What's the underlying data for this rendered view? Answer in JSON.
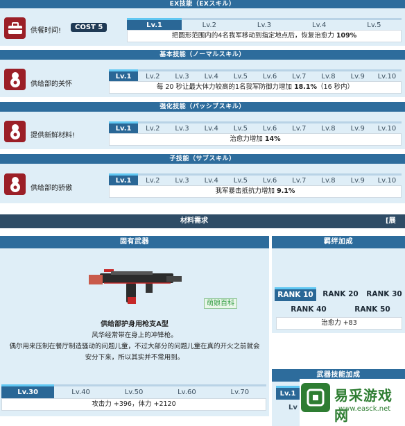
{
  "ex_skill": {
    "header": "EX技能（EXスキル）",
    "name": "供餐时间!",
    "cost": "COST 5",
    "levels": [
      "Lv.1",
      "Lv.2",
      "Lv.3",
      "Lv.4",
      "Lv.5"
    ],
    "desc_pre": "把圆形范围内的4名我军移动到指定地点后，恢复治愈力 ",
    "desc_bold": "109%"
  },
  "basic_skill": {
    "header": "基本技能（ノーマルスキル）",
    "name": "供给部的关怀",
    "levels": [
      "Lv.1",
      "Lv.2",
      "Lv.3",
      "Lv.4",
      "Lv.5",
      "Lv.6",
      "Lv.7",
      "Lv.8",
      "Lv.9",
      "Lv.10"
    ],
    "desc_pre": "每 20 秒让最大体力较高的1名我军防御力增加 ",
    "desc_bold": "18.1%",
    "desc_post": "（16 秒内）"
  },
  "enhanced_skill": {
    "header": "强化技能（パッシブスキル）",
    "name": "提供新鲜材料!",
    "levels": [
      "Lv.1",
      "Lv.2",
      "Lv.3",
      "Lv.4",
      "Lv.5",
      "Lv.6",
      "Lv.7",
      "Lv.8",
      "Lv.9",
      "Lv.10"
    ],
    "desc_pre": "治愈力增加 ",
    "desc_bold": "14%"
  },
  "sub_skill": {
    "header": "子技能（サブスキル）",
    "name": "供给部的骄傲",
    "levels": [
      "Lv.1",
      "Lv.2",
      "Lv.3",
      "Lv.4",
      "Lv.5",
      "Lv.6",
      "Lv.7",
      "Lv.8",
      "Lv.9",
      "Lv.10"
    ],
    "desc_pre": "我军暴击抵抗力增加 ",
    "desc_bold": "9.1%"
  },
  "materials": {
    "label": "材料需求",
    "expand": "[展开]"
  },
  "weapon": {
    "header": "固有武器",
    "name": "供给部护身用枪支A型",
    "desc1": "风华经常带在身上的冲锋枪。",
    "desc2": "偶尔用来压制在餐厅制造骚动的问题儿童，不过大部分的问题儿童在真的开火之前就会",
    "desc3": "安分下来，所以其实并不常用到。",
    "watermark": "萌娘百科",
    "levels": [
      "Lv.30",
      "Lv.40",
      "Lv.50",
      "Lv.60",
      "Lv.70"
    ],
    "stats": "攻击力 +396，体力 +2120"
  },
  "rank_bonus": {
    "header": "羁绊加成",
    "ranks": [
      "RANK 10",
      "RANK 20",
      "RANK 30",
      "RANK 40",
      "RANK 50"
    ],
    "stat": "治愈力 +83"
  },
  "weapon_skill_bonus": {
    "header": "武器技能加成",
    "level": "Lv.1",
    "level2": "Lv"
  },
  "site_logo": {
    "text": "易采游戏网",
    "url": "www.easck.net"
  },
  "colors": {
    "header_bg": "#2d6c9c",
    "section_bg": "#dfeef7",
    "icon_bg": "#9b1f27",
    "active_tab": "#2a6796",
    "active_tab_top": "#60c7f2",
    "logo_green": "#2e7d32"
  }
}
